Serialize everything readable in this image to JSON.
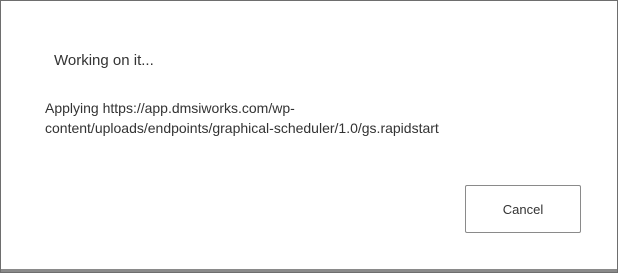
{
  "dialog": {
    "title": "Working on it...",
    "message_line_1": "Applying https://app.dmsiworks.com/wp-",
    "message_line_2": "content/uploads/endpoints/graphical-scheduler/1.0/gs.rapidstart",
    "cancel_label": "Cancel"
  }
}
